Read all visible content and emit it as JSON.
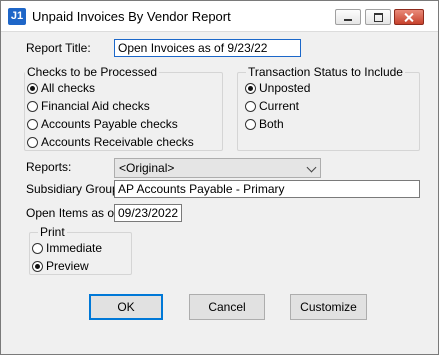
{
  "window": {
    "title": "Unpaid Invoices By Vendor Report",
    "icon_text": "J1",
    "controls": [
      "minimize-icon",
      "maximize-icon",
      "close-icon"
    ]
  },
  "report_title": {
    "label": "Report Title:",
    "value": "Open Invoices as of 9/23/22"
  },
  "checks_group": {
    "title": "Checks to be Processed",
    "options": [
      {
        "label": "All checks",
        "selected": true
      },
      {
        "label": "Financial Aid checks",
        "selected": false
      },
      {
        "label": "Accounts Payable checks",
        "selected": false
      },
      {
        "label": "Accounts Receivable checks",
        "selected": false
      }
    ]
  },
  "status_group": {
    "title": "Transaction Status to Include",
    "options": [
      {
        "label": "Unposted",
        "selected": true
      },
      {
        "label": "Current",
        "selected": false
      },
      {
        "label": "Both",
        "selected": false
      }
    ]
  },
  "reports": {
    "label": "Reports:",
    "value": "<Original>"
  },
  "subsidiary": {
    "label": "Subsidiary Group:",
    "value": "AP   Accounts Payable - Primary"
  },
  "open_items": {
    "label": "Open Items as of:",
    "value": "09/23/2022"
  },
  "print_group": {
    "title": "Print",
    "options": [
      {
        "label": "Immediate",
        "selected": false
      },
      {
        "label": "Preview",
        "selected": true
      }
    ]
  },
  "buttons": {
    "ok": "OK",
    "cancel": "Cancel",
    "customize": "Customize"
  }
}
